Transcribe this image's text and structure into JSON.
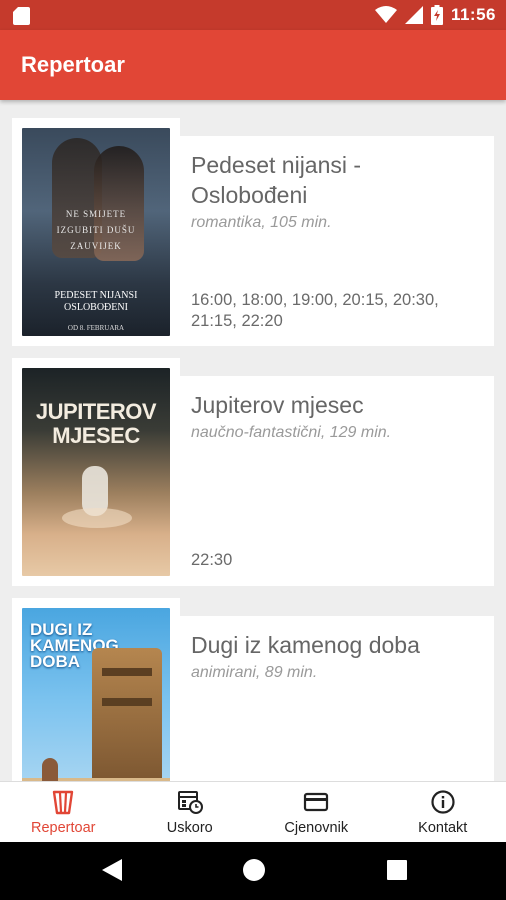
{
  "status_bar": {
    "time": "11:56",
    "icons": [
      "sim-card-icon",
      "wifi-icon",
      "signal-icon",
      "battery-charging-icon"
    ]
  },
  "app_bar": {
    "title": "Repertoar"
  },
  "movies": [
    {
      "title": "Pedeset nijansi - Oslobođeni",
      "genre": "romantika, 105 min.",
      "times": "16:00, 18:00, 19:00, 20:15, 20:30, 21:15, 22:20",
      "poster": {
        "tagline": "NE SMIJETE IZGUBITI DUŠU ZAUVIJEK",
        "name": "PEDESET NIJANSI OSLOBOĐENI",
        "date": "OD 8. FEBRUARA"
      }
    },
    {
      "title": "Jupiterov mjesec",
      "genre": "naučno-fantastični, 129 min.",
      "times": "22:30",
      "poster": {
        "name_line1": "JUPITEROV",
        "name_line2": "MJESEC"
      }
    },
    {
      "title": "Dugi iz kamenog doba",
      "genre": "animirani, 89 min.",
      "times": "",
      "poster": {
        "name_line1": "DUGI IZ",
        "name_line2": "KAMENOG",
        "name_line3": "DOBA"
      }
    }
  ],
  "bottom_nav": {
    "items": [
      {
        "label": "Repertoar",
        "icon": "popcorn-icon",
        "active": true
      },
      {
        "label": "Uskoro",
        "icon": "calendar-clock-icon",
        "active": false
      },
      {
        "label": "Cjenovnik",
        "icon": "credit-card-icon",
        "active": false
      },
      {
        "label": "Kontakt",
        "icon": "info-icon",
        "active": false
      }
    ]
  },
  "colors": {
    "primary": "#e14636",
    "primary_dark": "#c53a2c",
    "background": "#eeeeee"
  }
}
